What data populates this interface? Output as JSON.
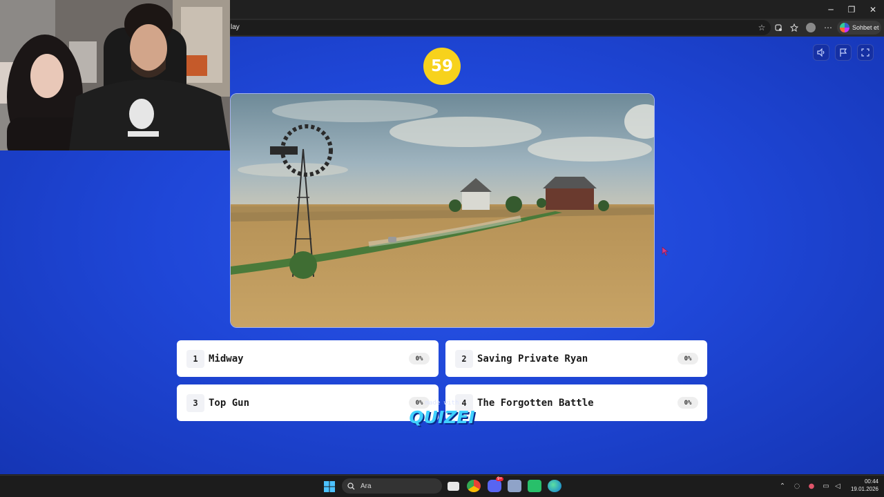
{
  "browser": {
    "url_fragment": "lay",
    "copilot_label": "Sohbet et",
    "window_controls": {
      "minimize": "─",
      "maximize": "❐",
      "close": "✕"
    }
  },
  "quiz": {
    "timer": "59",
    "answers": [
      {
        "number": "1",
        "title": "Midway",
        "percent": "0%"
      },
      {
        "number": "2",
        "title": "Saving Private Ryan",
        "percent": "0%"
      },
      {
        "number": "3",
        "title": "Top Gun",
        "percent": "0%"
      },
      {
        "number": "4",
        "title": "The Forgotten Battle",
        "percent": "0%"
      }
    ],
    "made_with": "made with",
    "brand": "QUIZEI",
    "controls": [
      "speaker-icon",
      "flag-icon",
      "fullscreen-icon"
    ]
  },
  "taskbar": {
    "search_label": "Ara",
    "time": "00:44",
    "date": "19.01.2026",
    "discord_badge": "9+"
  },
  "colors": {
    "page_bg": "#1f47d8",
    "timer_bg": "#f7d21c",
    "brand": "#3fd0ff"
  }
}
